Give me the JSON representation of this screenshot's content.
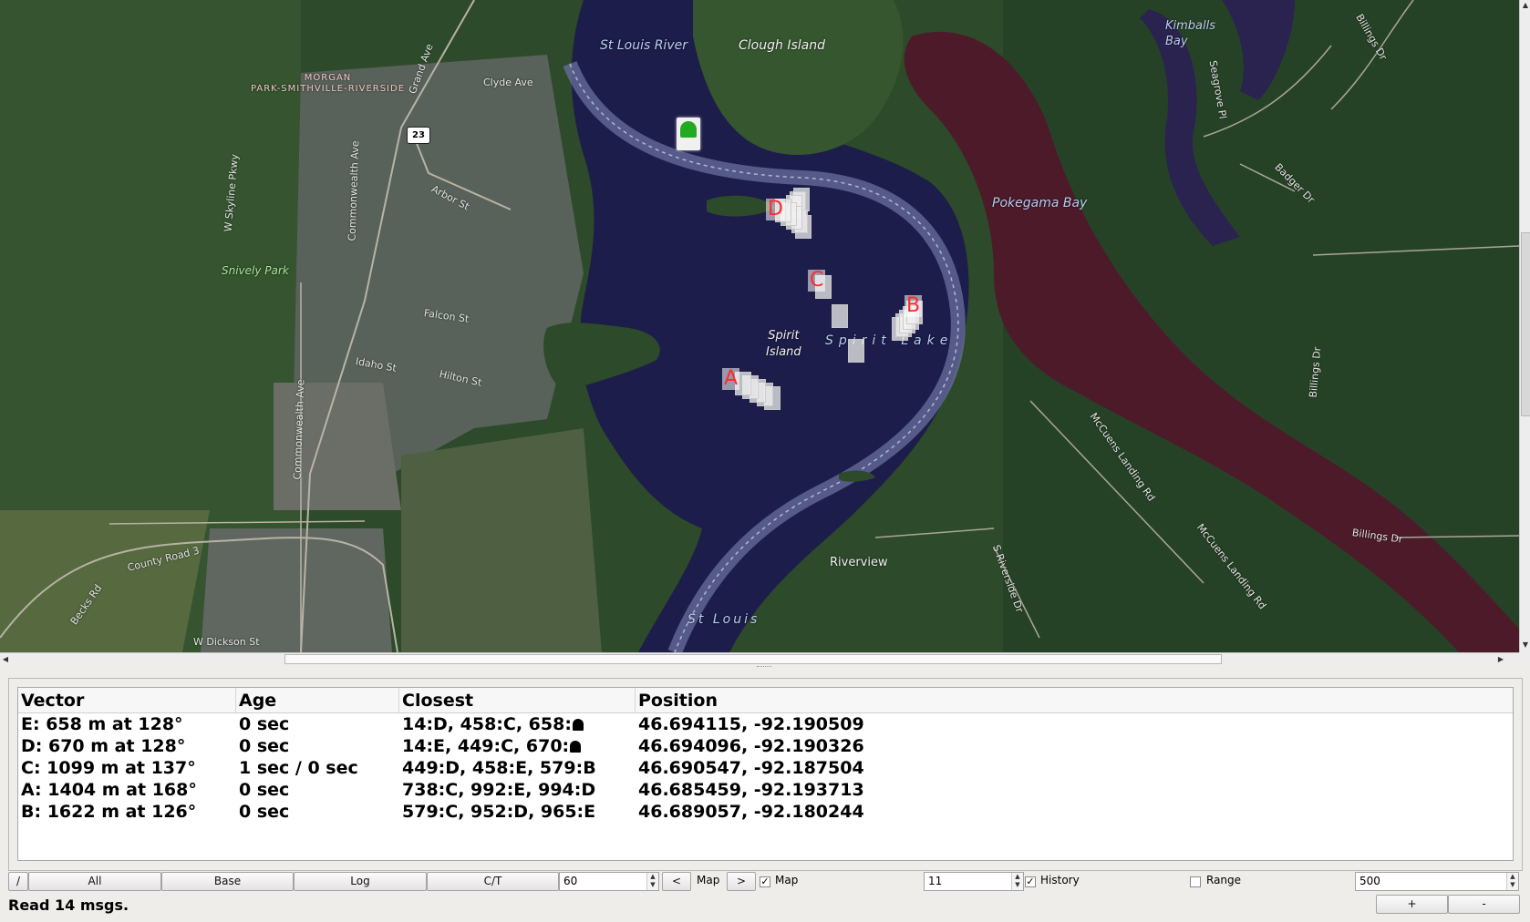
{
  "map": {
    "labels": {
      "st_louis_river": "St Louis River",
      "clough_island": "Clough Island",
      "kimballs_bay": "Kimballs\nBay",
      "morgan_park": "MORGAN\nPARK-SMITHVILLE-RIVERSIDE",
      "clyde_ave": "Clyde Ave",
      "grand_ave": "Grand Ave",
      "arbor_st": "Arbor St",
      "w_skyline_pkwy": "W Skyline Pkwy",
      "commonwealth_ave": "Commonwealth Ave",
      "commonwealth_ave_2": "Commonwealth Ave",
      "sherwood_park": "Snively Park",
      "falcon_st": "Falcon St",
      "idaho_st": "Idaho St",
      "hilton_st": "Hilton St",
      "spirit_island": "Spirit\nIsland",
      "spirit_lake": "Spirit Lake",
      "pokegama_bay": "Pokegama Bay",
      "riverview": "Riverview",
      "st_louis": "St Louis",
      "county_road_3": "County Road 3",
      "w_dickson_st": "W Dickson St",
      "beck_rd": "Becks Rd",
      "billings_dr": "Billings Dr",
      "billings_dr_2": "Billings Dr",
      "billings_dr_3": "Billings Dr",
      "badger_dr": "Badger Dr",
      "mccuen_landing_rd": "McCuens Landing Rd",
      "mccuen_landing_rd_2": "McCuens Landing Rd",
      "s_riverside_dr": "S Riverside Dr",
      "seagrove": "Seagrove Pl",
      "route_shield": "23"
    },
    "vessel_letters": [
      "D",
      "C",
      "B",
      "A"
    ]
  },
  "table": {
    "headers": [
      "Vector",
      "Age",
      "Closest",
      "Position"
    ],
    "rows": [
      {
        "vector": "E: 658 m at 128°",
        "age": "0 sec",
        "closest": "14:D, 458:C, 658:",
        "closest_home": true,
        "position": "46.694115, -92.190509"
      },
      {
        "vector": "D: 670 m at 128°",
        "age": "0 sec",
        "closest": "14:E, 449:C, 670:",
        "closest_home": true,
        "position": "46.694096, -92.190326"
      },
      {
        "vector": "C: 1099 m at 137°",
        "age": "1 sec / 0 sec",
        "closest": "449:D, 458:E, 579:B",
        "closest_home": false,
        "position": "46.690547, -92.187504"
      },
      {
        "vector": "A: 1404 m at 168°",
        "age": "0 sec",
        "closest": "738:C, 992:E, 994:D",
        "closest_home": false,
        "position": "46.685459, -92.193713"
      },
      {
        "vector": "B: 1622 m at 126°",
        "age": "0 sec",
        "closest": "579:C, 952:D, 965:E",
        "closest_home": false,
        "position": "46.689057, -92.180244"
      }
    ]
  },
  "controls": {
    "slash_button": "/",
    "all_button": "All",
    "base_button": "Base",
    "log_button": "Log",
    "ct_button": "C/T",
    "interval_value": "60",
    "prev_button": "<",
    "map_label_left": "Map",
    "next_button": ">",
    "map_checkbox_checked": true,
    "map_checkbox_label": "Map",
    "zoom_value": "11",
    "history_checked": true,
    "history_label": "History",
    "range_checked": false,
    "range_label": "Range",
    "range_value": "500",
    "plus_button": "+",
    "minus_button": "-",
    "checkmark": "✓"
  },
  "status": {
    "text": "Read 14 msgs."
  },
  "colors": {
    "water": "#1c1d4a",
    "marsh": "#4d1a2a",
    "forest": "#2f4a2c",
    "vessel_letter": "#ff2a2a",
    "home_marker": "#22aa22"
  }
}
